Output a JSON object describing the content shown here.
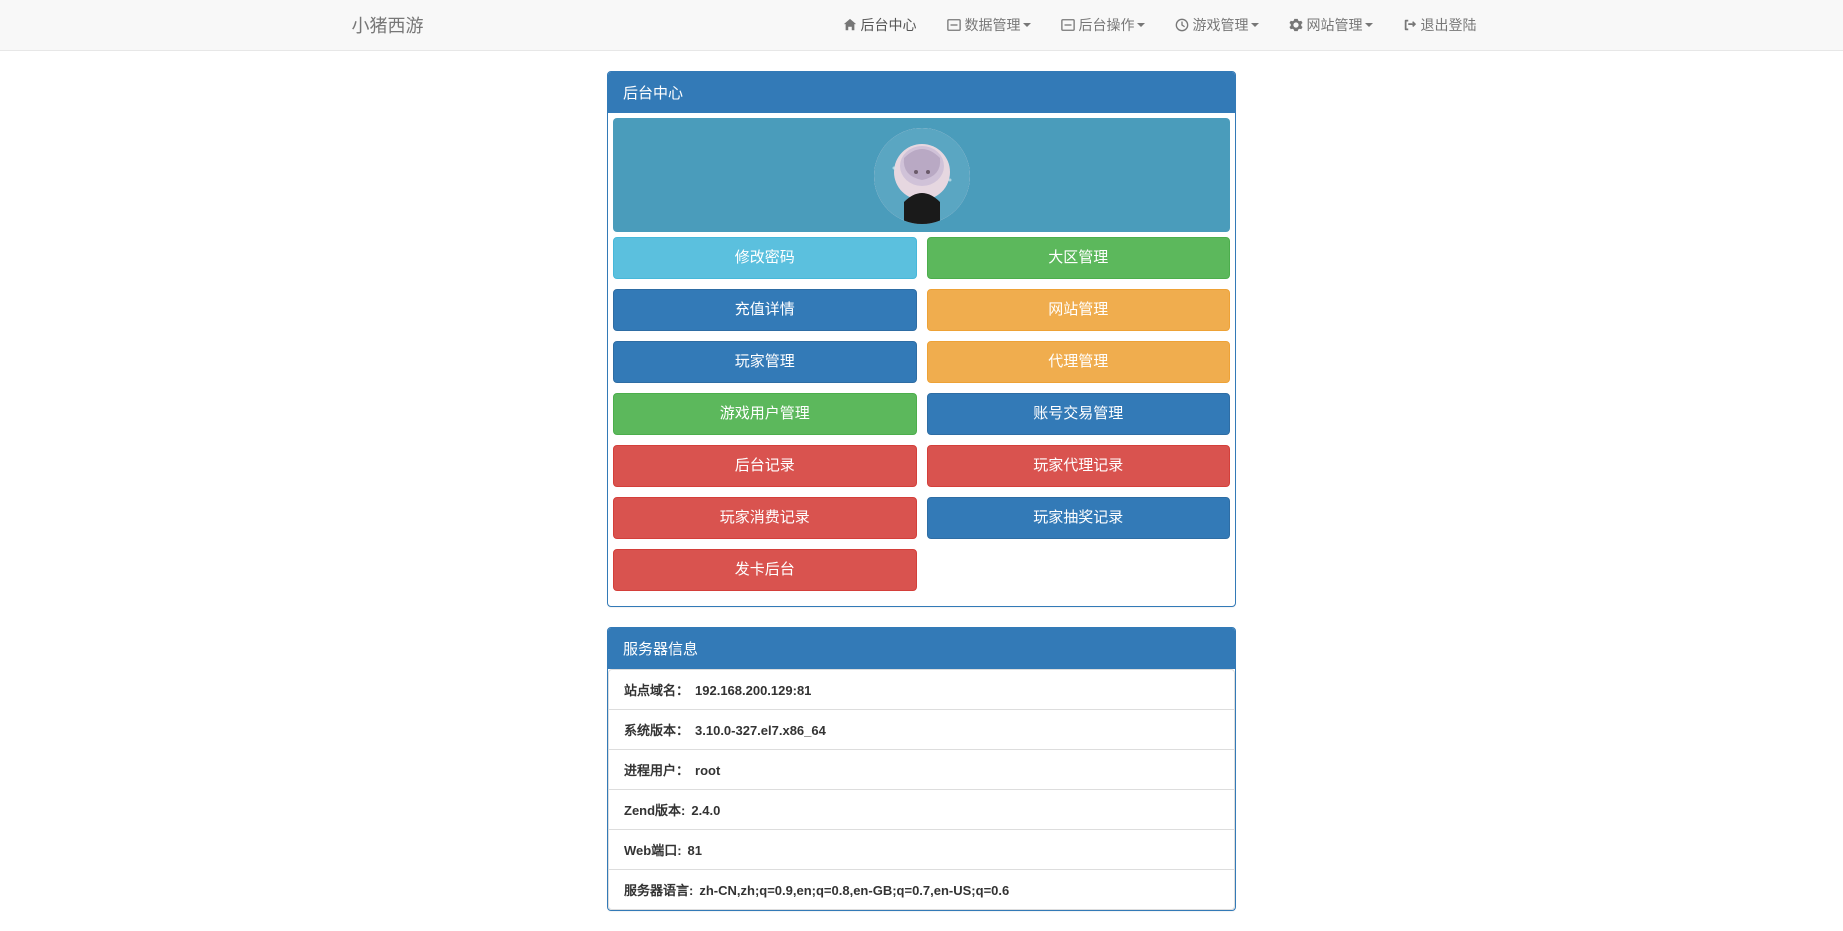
{
  "brand": "小猪西游",
  "nav": [
    {
      "icon": "home",
      "label": "后台中心",
      "dropdown": false,
      "active": true
    },
    {
      "icon": "minus-square",
      "label": "数据管理",
      "dropdown": true
    },
    {
      "icon": "minus-square",
      "label": "后台操作",
      "dropdown": true
    },
    {
      "icon": "clock",
      "label": "游戏管理",
      "dropdown": true
    },
    {
      "icon": "gear",
      "label": "网站管理",
      "dropdown": true
    },
    {
      "icon": "signout",
      "label": "退出登陆",
      "dropdown": false
    }
  ],
  "panel1": {
    "title": "后台中心"
  },
  "buttons": [
    {
      "label": "修改密码",
      "cls": "btn-info"
    },
    {
      "label": "大区管理",
      "cls": "btn-success"
    },
    {
      "label": "充值详情",
      "cls": "btn-primary"
    },
    {
      "label": "网站管理",
      "cls": "btn-warning"
    },
    {
      "label": "玩家管理",
      "cls": "btn-primary"
    },
    {
      "label": "代理管理",
      "cls": "btn-warning"
    },
    {
      "label": "游戏用户管理",
      "cls": "btn-success"
    },
    {
      "label": "账号交易管理",
      "cls": "btn-primary"
    },
    {
      "label": "后台记录",
      "cls": "btn-danger"
    },
    {
      "label": "玩家代理记录",
      "cls": "btn-danger"
    },
    {
      "label": "玩家消费记录",
      "cls": "btn-danger"
    },
    {
      "label": "玩家抽奖记录",
      "cls": "btn-primary"
    },
    {
      "label": "发卡后台",
      "cls": "btn-danger"
    }
  ],
  "panel2": {
    "title": "服务器信息"
  },
  "server": [
    {
      "label": "站点域名：",
      "value": "192.168.200.129:81"
    },
    {
      "label": "系统版本：",
      "value": "3.10.0-327.el7.x86_64"
    },
    {
      "label": "进程用户：",
      "value": "root"
    },
    {
      "label": "Zend版本:",
      "value": "2.4.0"
    },
    {
      "label": "Web端口:",
      "value": "81"
    },
    {
      "label": "服务器语言:",
      "value": "zh-CN,zh;q=0.9,en;q=0.8,en-GB;q=0.7,en-US;q=0.6"
    }
  ]
}
